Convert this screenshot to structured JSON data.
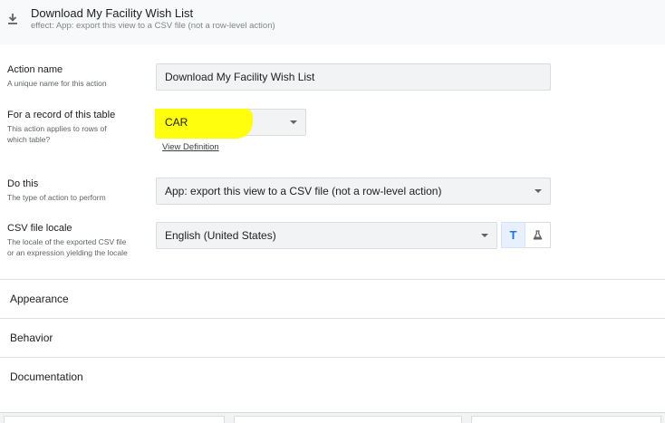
{
  "header": {
    "icon": "download-icon",
    "title": "Download My Facility Wish List",
    "subtitle": "effect: App: export this view to a CSV file (not a row-level action)"
  },
  "form": {
    "action_name": {
      "label": "Action name",
      "description": "A unique name for this action",
      "value": "Download My Facility Wish List"
    },
    "table": {
      "label": "For a record of this table",
      "description_line1": "This action applies to rows of",
      "description_line2": "which table?",
      "value": "CAR",
      "link": "View Definition",
      "highlight_color": "#ffff00"
    },
    "do_this": {
      "label": "Do this",
      "description": "The type of action to perform",
      "value": "App: export this view to a CSV file (not a row-level action)"
    },
    "locale": {
      "label": "CSV file locale",
      "description_line1": "The locale of the exported CSV file",
      "description_line2": "or an expression yielding the locale",
      "value": "English (United States)",
      "text_mode_glyph": "T",
      "text_mode_icon": "text-mode-icon",
      "expression_mode_icon": "flask-icon"
    }
  },
  "sections": [
    {
      "label": "Appearance"
    },
    {
      "label": "Behavior"
    },
    {
      "label": "Documentation"
    }
  ],
  "colors": {
    "accent": "#1a73e8",
    "field_bg": "#f1f3f4"
  }
}
